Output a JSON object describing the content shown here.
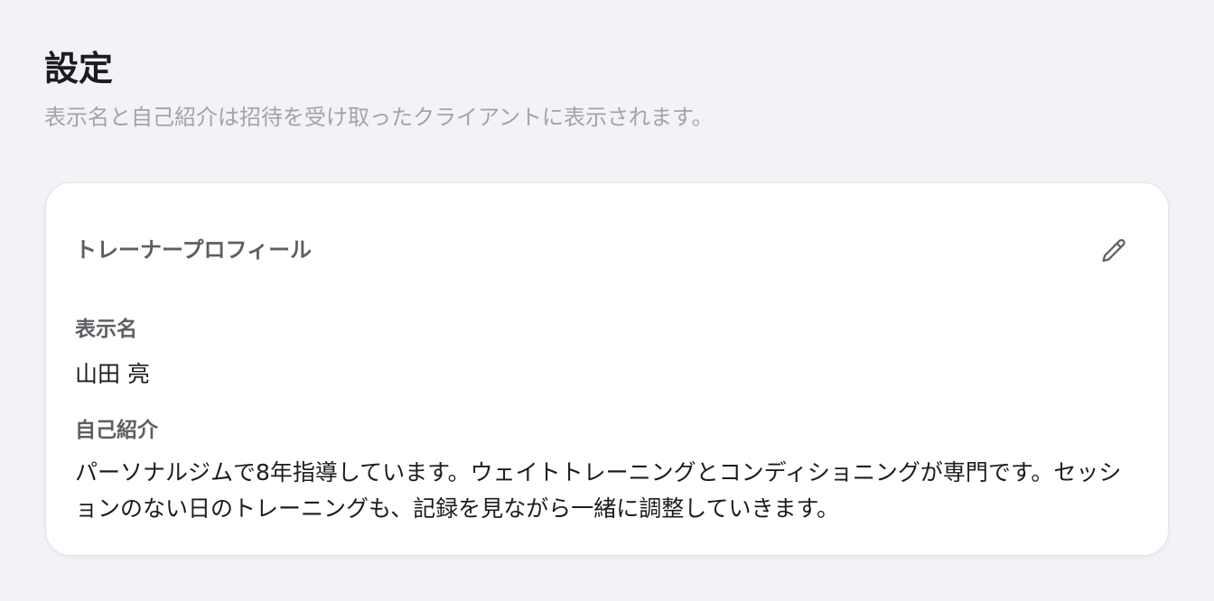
{
  "header": {
    "title": "設定",
    "subtitle": "表示名と自己紹介は招待を受け取ったクライアントに表示されます。"
  },
  "profile_card": {
    "title": "トレーナープロフィール",
    "edit_icon": "pencil-icon",
    "display_name_label": "表示名",
    "display_name_value": "山田 亮",
    "bio_label": "自己紹介",
    "bio_value": "パーソナルジムで8年指導しています。ウェイトトレーニングとコンディショニングが専門です。セッションのない日のトレーニングも、記録を見ながら一緒に調整していきます。"
  },
  "colors": {
    "background": "#f2f2f7",
    "card": "#ffffff",
    "text_primary": "#1c1c1e",
    "text_secondary": "#5e5e63",
    "text_muted": "#a3a3a8"
  }
}
